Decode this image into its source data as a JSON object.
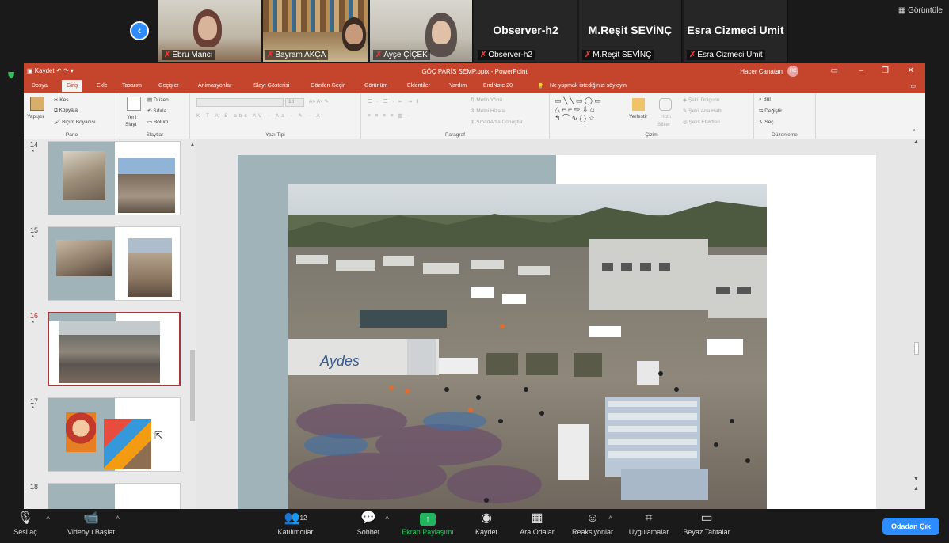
{
  "zoom": {
    "view_label": "Görüntüle",
    "participants": [
      {
        "name": "Ebru Mancı",
        "type": "video"
      },
      {
        "name": "Bayram AKÇA",
        "type": "video"
      },
      {
        "name": "Ayşe ÇİÇEK",
        "type": "video"
      },
      {
        "name": "Observer-h2",
        "type": "name"
      },
      {
        "name": "M.Reşit SEVİNÇ",
        "type": "name"
      },
      {
        "name": "Esra Cizmeci Umit",
        "type": "name"
      }
    ],
    "controls": {
      "mute_label": "Sesi aç",
      "video_label": "Videoyu Başlat",
      "participants_label": "Katılımcılar",
      "participants_count": "12",
      "chat_label": "Sohbet",
      "share_label": "Ekran Paylaşımı",
      "record_label": "Kaydet",
      "breakout_label": "Ara Odalar",
      "reactions_label": "Reaksiyonlar",
      "apps_label": "Uygulamalar",
      "whiteboard_label": "Beyaz Tahtalar",
      "leave_label": "Odadan Çık"
    }
  },
  "powerpoint": {
    "window_title": "GÖÇ PARİS SEMP.pptx - PowerPoint",
    "qat_label": "Kaydet",
    "user_name": "Hacer Canatan",
    "user_initials": "HC",
    "tabs": [
      "Dosya",
      "Giriş",
      "Ekle",
      "Tasarım",
      "Geçişler",
      "Animasyonlar",
      "Slayt Gösterisi",
      "Gözden Geçir",
      "Görünüm",
      "Eklentiler",
      "Yardım",
      "EndNote 20"
    ],
    "active_tab": "Giriş",
    "tell_me": "Ne yapmak istediğinizi söyleyin",
    "ribbon": {
      "clipboard": {
        "paste": "Yapıştır",
        "cut": "Kes",
        "copy": "Kopyala",
        "format_painter": "Biçim Boyacısı",
        "group": "Pano"
      },
      "slides": {
        "new_slide_1": "Yeni",
        "new_slide_2": "Slayt",
        "layout": "Düzen",
        "reset": "Sıfırla",
        "section": "Bölüm",
        "group": "Slaytlar"
      },
      "font": {
        "size": "18",
        "group": "Yazı Tipi"
      },
      "paragraph": {
        "text_direction": "Metin Yönü",
        "align_text": "Metni Hizala",
        "smartart": "SmartArt'a Dönüştür",
        "group": "Paragraf"
      },
      "drawing": {
        "arrange": "Yerleştir",
        "quick_styles_1": "Hızlı",
        "quick_styles_2": "Stiller",
        "shape_fill": "Şekil Dolgusu",
        "shape_outline": "Şekil Ana Hattı",
        "shape_effects": "Şekil Efektleri",
        "group": "Çizim"
      },
      "editing": {
        "find": "Bul",
        "replace": "Değiştir",
        "select": "Seç",
        "group": "Düzenleme"
      }
    },
    "thumbnails": [
      {
        "number": "14",
        "star": "*"
      },
      {
        "number": "15",
        "star": "*"
      },
      {
        "number": "16",
        "star": "*"
      },
      {
        "number": "17",
        "star": "*"
      },
      {
        "number": "18",
        "star": ""
      }
    ],
    "selected_slide": "16"
  },
  "colors": {
    "ppt_accent": "#c4442c",
    "zoom_blue": "#2d8cff",
    "share_green": "#23b45e",
    "slide_teal": "#9fb3b8",
    "selection_border": "#a4373a"
  }
}
